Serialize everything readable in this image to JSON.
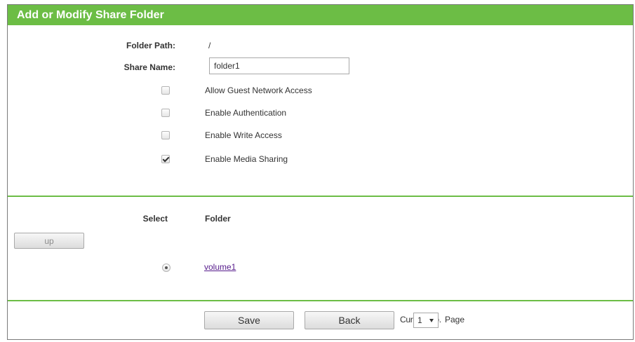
{
  "header": {
    "title": "Add or Modify Share Folder"
  },
  "form": {
    "folder_path_label": "Folder Path:",
    "folder_path_value": "/",
    "share_name_label": "Share Name:",
    "share_name_value": "folder1",
    "options": [
      {
        "label": "Allow Guest Network Access",
        "checked": false
      },
      {
        "label": "Enable Authentication",
        "checked": false
      },
      {
        "label": "Enable Write Access",
        "checked": false
      },
      {
        "label": "Enable Media Sharing",
        "checked": true
      }
    ]
  },
  "browser": {
    "select_header": "Select",
    "folder_header": "Folder",
    "up_label": "up",
    "folders": [
      {
        "name": "volume1",
        "selected": true
      }
    ]
  },
  "footer": {
    "save_label": "Save",
    "back_label": "Back",
    "current_no_label": "Current No.",
    "current_page": "1",
    "page_label": "Page"
  },
  "colors": {
    "accent": "#6cbd45",
    "link": "#551a8b"
  }
}
